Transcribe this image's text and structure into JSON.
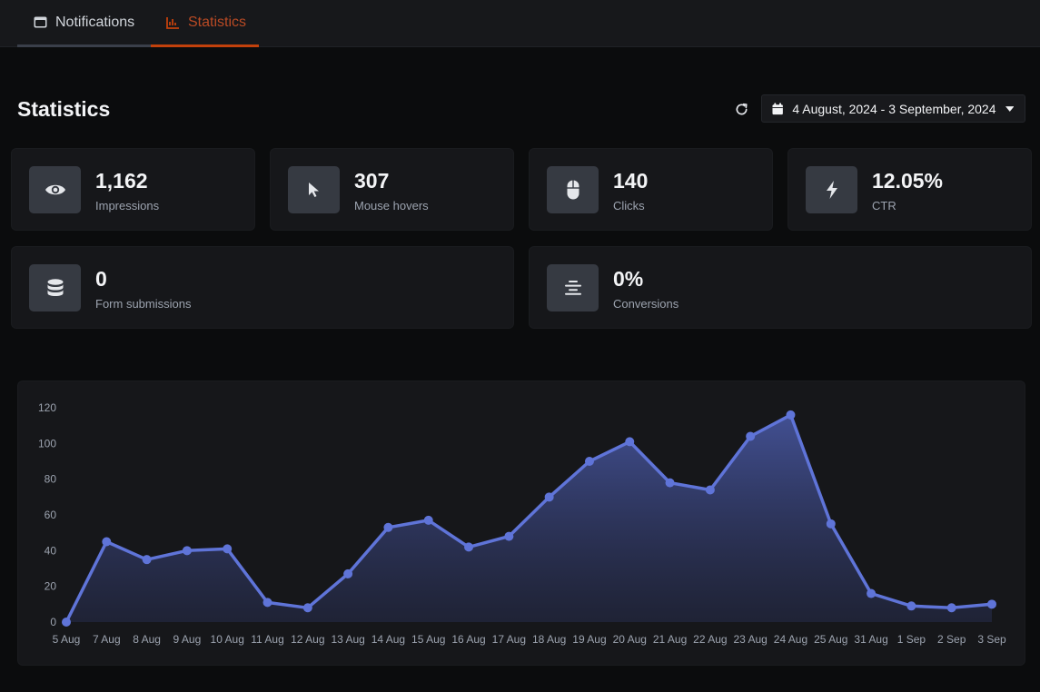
{
  "tabs": [
    {
      "label": "Notifications",
      "icon": "window-icon",
      "active": false
    },
    {
      "label": "Statistics",
      "icon": "chart-icon",
      "active": true
    }
  ],
  "header": {
    "title": "Statistics",
    "date_range": "4 August, 2024 - 3 September, 2024"
  },
  "stats": [
    {
      "value": "1,162",
      "label": "Impressions",
      "icon": "eye-icon"
    },
    {
      "value": "307",
      "label": "Mouse hovers",
      "icon": "cursor-icon"
    },
    {
      "value": "140",
      "label": "Clicks",
      "icon": "mouse-icon"
    },
    {
      "value": "12.05%",
      "label": "CTR",
      "icon": "bolt-icon"
    },
    {
      "value": "0",
      "label": "Form submissions",
      "icon": "database-icon"
    },
    {
      "value": "0%",
      "label": "Conversions",
      "icon": "align-center-icon"
    }
  ],
  "colors": {
    "accent": "#c2410c",
    "line": "#5f74d8",
    "card": "#16171a",
    "background": "#0b0c0d"
  },
  "chart_data": {
    "type": "area",
    "categories": [
      "5 Aug",
      "7 Aug",
      "8 Aug",
      "9 Aug",
      "10 Aug",
      "11 Aug",
      "12 Aug",
      "13 Aug",
      "14 Aug",
      "15 Aug",
      "16 Aug",
      "17 Aug",
      "18 Aug",
      "19 Aug",
      "20 Aug",
      "21 Aug",
      "22 Aug",
      "23 Aug",
      "24 Aug",
      "25 Aug",
      "31 Aug",
      "1 Sep",
      "2 Sep",
      "3 Sep"
    ],
    "series": [
      {
        "values": [
          0,
          45,
          35,
          40,
          41,
          11,
          8,
          27,
          53,
          57,
          42,
          48,
          70,
          90,
          101,
          78,
          74,
          104,
          116,
          55,
          16,
          9,
          8,
          10
        ]
      }
    ],
    "ylim": [
      0,
      120
    ],
    "yticks": [
      0,
      20,
      40,
      60,
      80,
      100,
      120
    ],
    "grid": false,
    "legend": "none"
  }
}
